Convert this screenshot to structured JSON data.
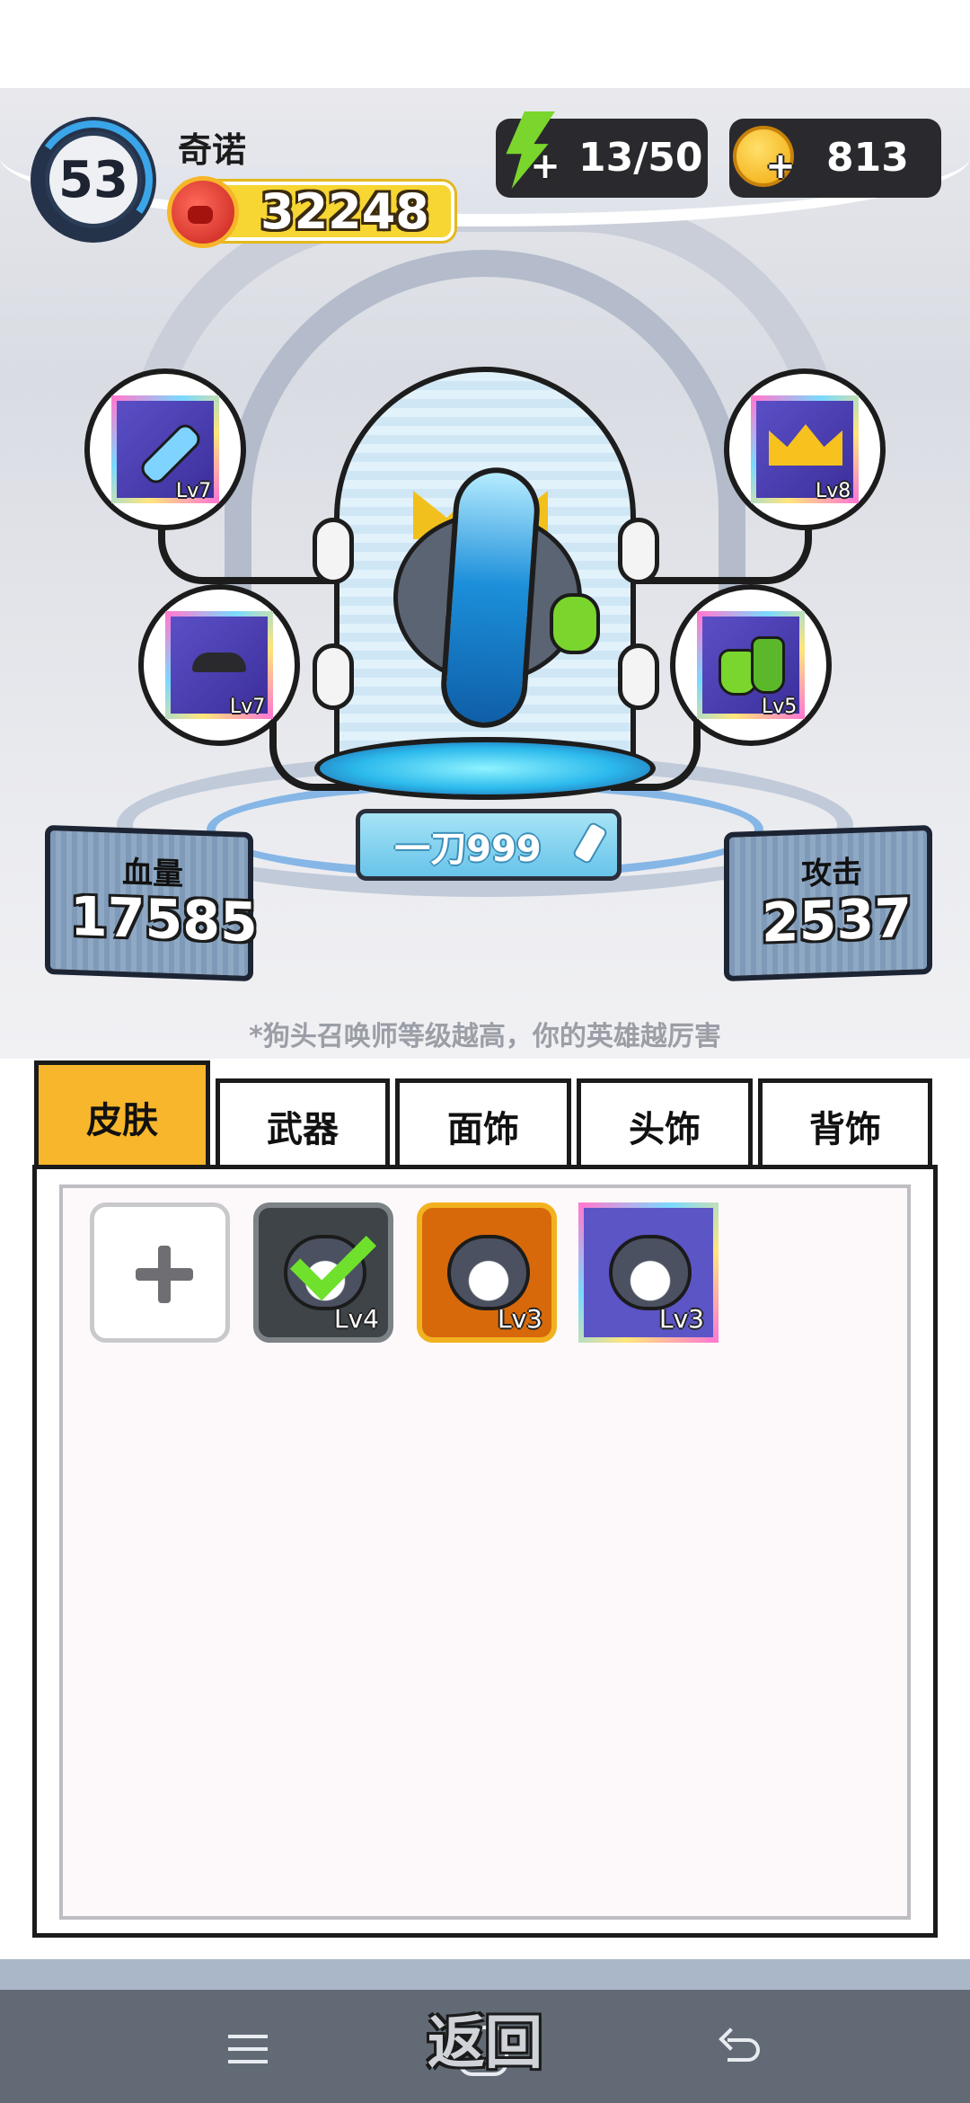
{
  "player": {
    "level": "53",
    "name": "奇诺",
    "power": "32248"
  },
  "resources": {
    "energy": "13/50",
    "coins": "813"
  },
  "equipment": {
    "top_left": {
      "icon": "skateboard-icon",
      "level": "Lv7"
    },
    "bottom_left": {
      "icon": "mustache-icon",
      "level": "Lv7"
    },
    "top_right": {
      "icon": "crown-icon",
      "level": "Lv8"
    },
    "bottom_right": {
      "icon": "potion-icon",
      "level": "Lv5"
    }
  },
  "hero": {
    "name": "一刀999"
  },
  "stats": {
    "hp": {
      "label": "血量",
      "value": "17585"
    },
    "attack": {
      "label": "攻击",
      "value": "2537"
    }
  },
  "hint": "*狗头召唤师等级越高，你的英雄越厉害",
  "tabs": [
    "皮肤",
    "武器",
    "面饰",
    "头饰",
    "背饰"
  ],
  "active_tab": "皮肤",
  "skins": [
    {
      "level": "Lv4",
      "selected": true,
      "frame": "gray"
    },
    {
      "level": "Lv3",
      "selected": false,
      "frame": "orange"
    },
    {
      "level": "Lv3",
      "selected": false,
      "frame": "rainbow"
    }
  ],
  "back_label": "返回",
  "colors": {
    "accent_tab": "#f7b62b",
    "power_pill": "#f7d532",
    "energy": "#7ad62d",
    "coin": "#f2a90d"
  }
}
